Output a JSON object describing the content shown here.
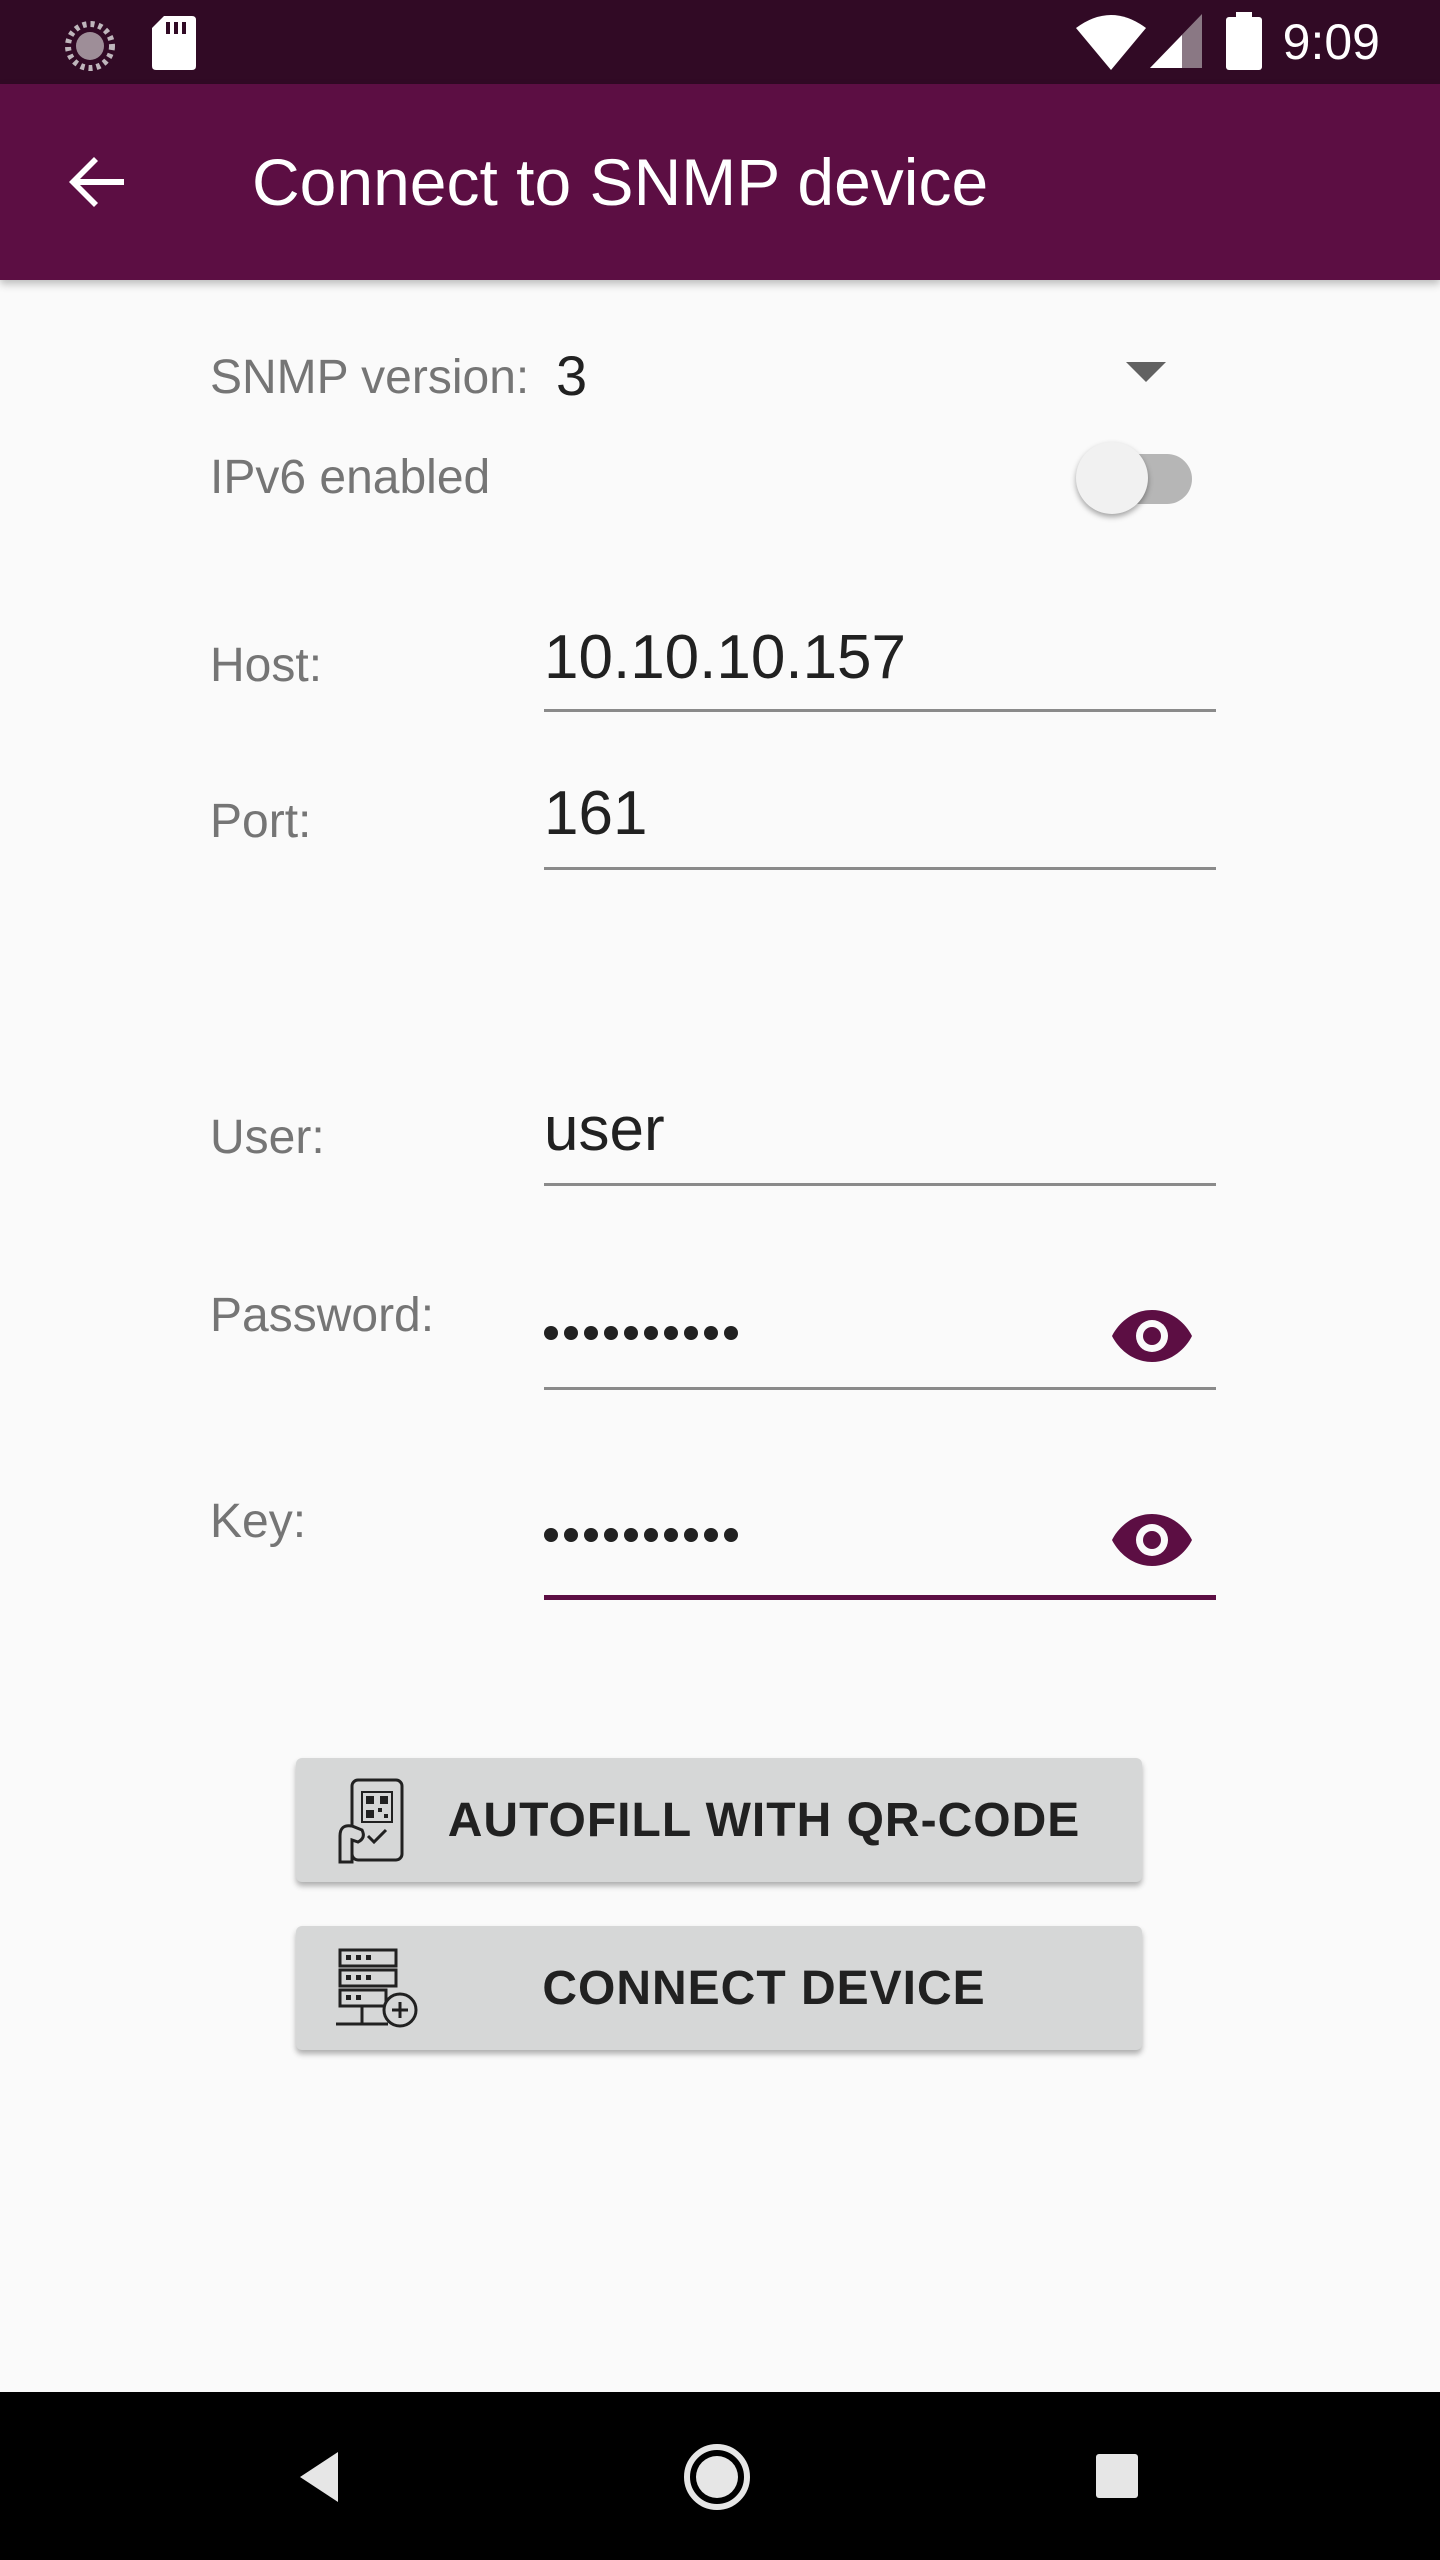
{
  "status_bar": {
    "time": "9:09",
    "icons": [
      "sync-icon",
      "sd-card-icon",
      "wifi-icon",
      "cell-signal-icon",
      "battery-icon"
    ]
  },
  "app_bar": {
    "title": "Connect to SNMP device",
    "back_icon": "arrow-back-icon"
  },
  "form": {
    "snmp_version_label": "SNMP version:",
    "snmp_version_value": "3",
    "ipv6_label": "IPv6 enabled",
    "ipv6_enabled": false,
    "host_label": "Host:",
    "host_value": "10.10.10.157",
    "port_label": "Port:",
    "port_value": "161",
    "user_label": "User:",
    "user_value": "user",
    "password_label": "Password:",
    "password_masked_length": 10,
    "key_label": "Key:",
    "key_masked_length": 10
  },
  "buttons": {
    "autofill_label": "AUTOFILL WITH QR-CODE",
    "connect_label": "CONNECT DEVICE"
  },
  "colors": {
    "primary": "#5c0e43",
    "primary_dark": "#310a25",
    "background": "#fafafa",
    "button_bg": "#d6d7d7"
  }
}
